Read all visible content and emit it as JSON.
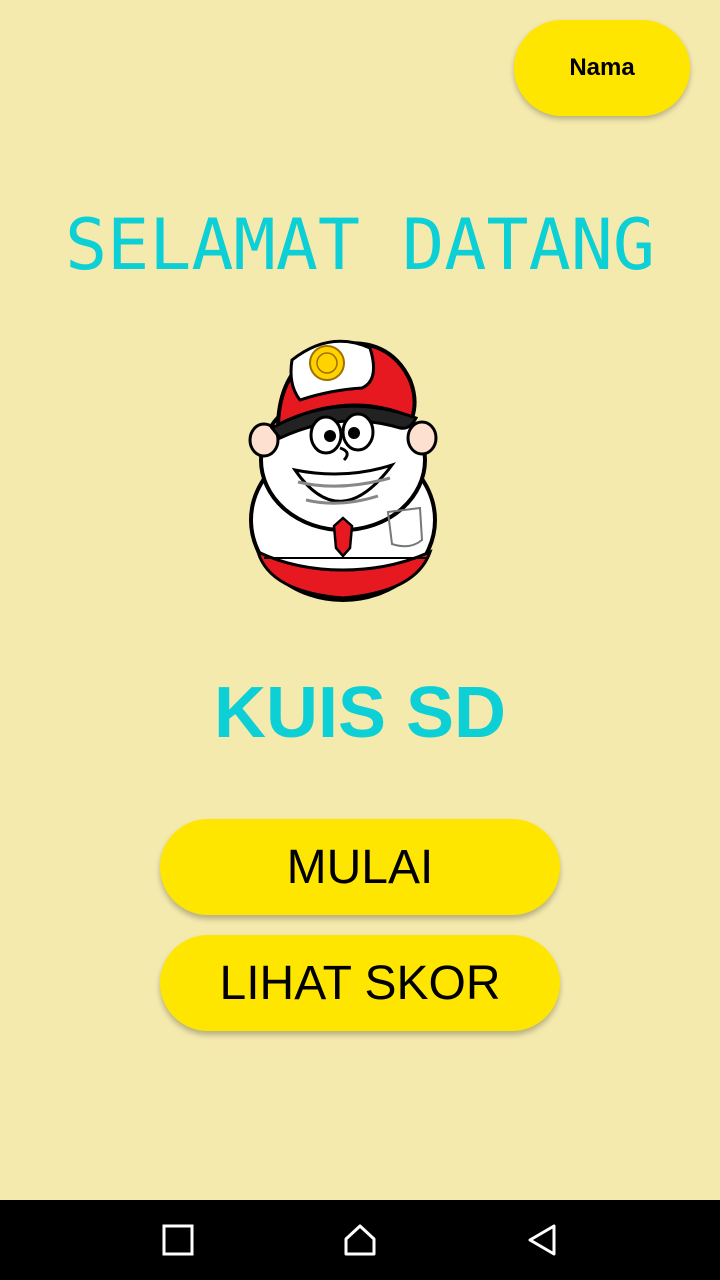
{
  "header": {
    "name_button_label": "Nama"
  },
  "main": {
    "welcome_title": "SELAMAT DATANG",
    "mascot_icon": "student-mascot",
    "app_title": "KUIS SD",
    "start_button_label": "MULAI",
    "score_button_label": "LIHAT SKOR"
  },
  "nav_bar": {
    "icons": [
      "recents-square-icon",
      "home-icon",
      "back-triangle-icon"
    ]
  },
  "colors": {
    "background": "#f5eaae",
    "button": "#ffe600",
    "title": "#0dcfd6",
    "nav_bar": "#000000"
  }
}
